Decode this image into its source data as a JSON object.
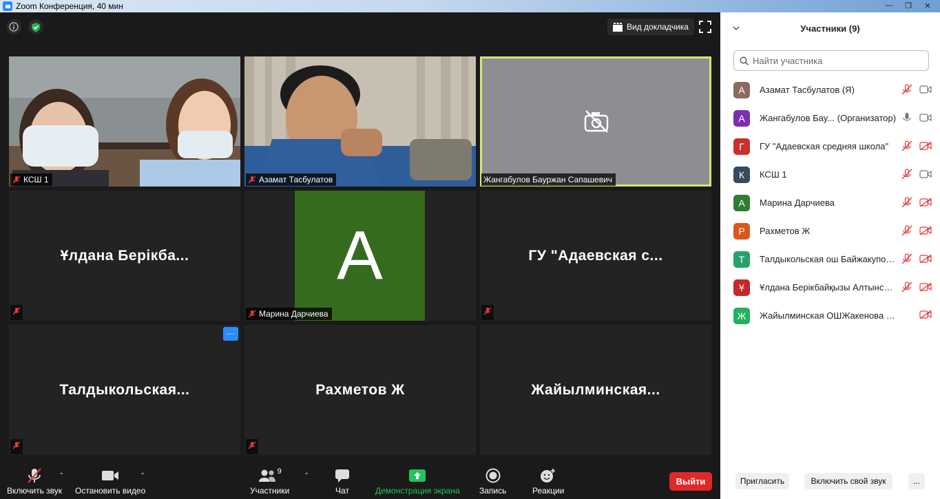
{
  "window": {
    "title": "Zoom Конференция, 40 мин"
  },
  "top": {
    "speaker_view_label": "Вид докладчика"
  },
  "tiles": [
    {
      "name": "КСШ 1",
      "video": true
    },
    {
      "name": "Азамат Тасбулатов",
      "video": true
    },
    {
      "name": "Жангабулов Бауржан Сапашевич",
      "video": false,
      "camera_off": true,
      "active_speaker": true
    },
    {
      "bigname": "Ұлдана Берікба..."
    },
    {
      "name": "Марина Дарчиева",
      "avatar_letter": "А",
      "avatar_color": "#356b1e"
    },
    {
      "bigname": "ГУ \"Адаевская с..."
    },
    {
      "bigname": "Талдыкольская..."
    },
    {
      "bigname": "Рахметов Ж"
    },
    {
      "bigname": "Жайылминская..."
    }
  ],
  "toolbar": {
    "mute_label": "Включить звук",
    "video_label": "Остановить видео",
    "participants_label": "Участники",
    "participants_count": "9",
    "chat_label": "Чат",
    "share_label": "Демонстрация экрана",
    "record_label": "Запись",
    "reactions_label": "Реакции",
    "leave_label": "Выйти"
  },
  "panel": {
    "title": "Участники (9)",
    "search_placeholder": "Найти участника",
    "participants": [
      {
        "letter": "А",
        "color": "#8c6b5e",
        "name": "Азамат Тасбулатов (Я)",
        "role": "",
        "mic": "muted",
        "cam": "on"
      },
      {
        "letter": "А",
        "color": "#7b2fb0",
        "name": "Жангабулов Бау...",
        "role": "(Организатор)",
        "mic": "on",
        "cam": "on"
      },
      {
        "letter": "Г",
        "color": "#c9302c",
        "name": "ГУ \"Адаевская средняя школа\"",
        "role": "",
        "mic": "muted",
        "cam": "off"
      },
      {
        "letter": "К",
        "color": "#344a5e",
        "name": "КСШ 1",
        "role": "",
        "mic": "muted",
        "cam": "on"
      },
      {
        "letter": "А",
        "color": "#2e7d32",
        "name": "Марина Дарчиева",
        "role": "",
        "mic": "muted",
        "cam": "off"
      },
      {
        "letter": "Р",
        "color": "#d9581d",
        "name": "Рахметов Ж",
        "role": "",
        "mic": "muted",
        "cam": "off"
      },
      {
        "letter": "Т",
        "color": "#26a369",
        "name": "Талдыкольская ош Байжакупов...",
        "role": "",
        "mic": "muted",
        "cam": "off"
      },
      {
        "letter": "Ұ",
        "color": "#c62828",
        "name": "Ұлдана Берікбайқызы Алтынсар...",
        "role": "",
        "mic": "muted",
        "cam": "off"
      },
      {
        "letter": "Ж",
        "color": "#21b35a",
        "name": "Жайылминская ОШЖакенова А.М.",
        "role": "",
        "mic": "none",
        "cam": "off"
      }
    ],
    "invite_label": "Пригласить",
    "unmute_me_label": "Включить свой звук",
    "more_label": "..."
  }
}
